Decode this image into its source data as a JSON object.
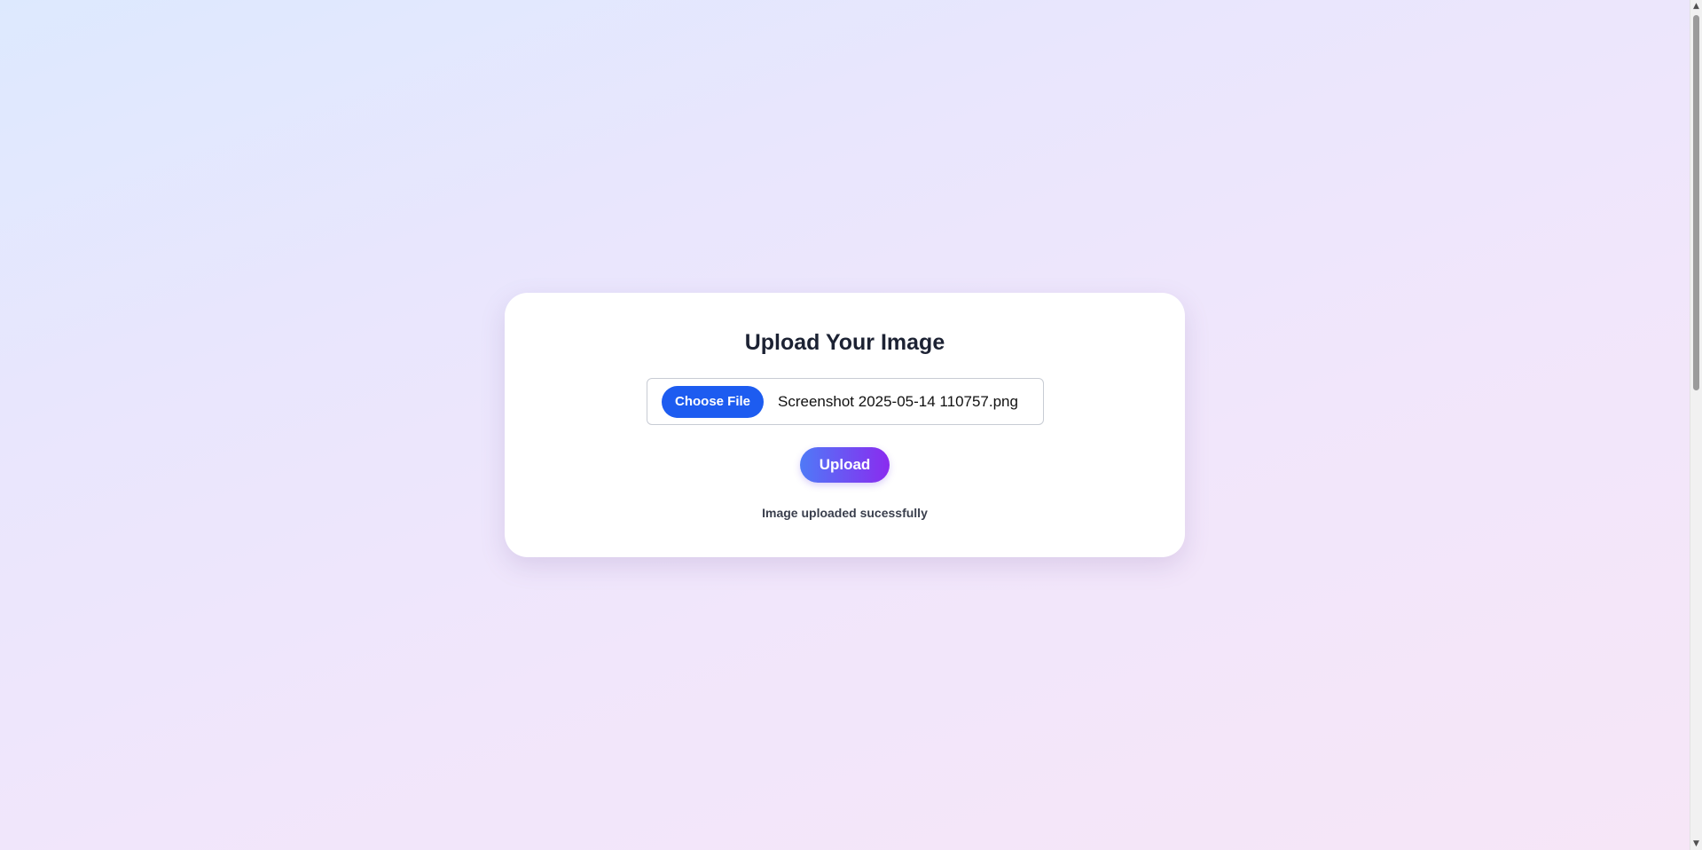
{
  "card": {
    "title": "Upload Your Image",
    "choose_file_label": "Choose File",
    "selected_file": "Screenshot 2025-05-14 110757.png",
    "upload_label": "Upload",
    "status_message": "Image uploaded sucessfully"
  },
  "colors": {
    "choose_button": "#1d5cf0",
    "upload_gradient_start": "#4f7af7",
    "upload_gradient_end": "#8a2bef"
  },
  "icons": {
    "scroll_up": "scroll-up-arrow-icon",
    "scroll_down": "scroll-down-arrow-icon"
  }
}
